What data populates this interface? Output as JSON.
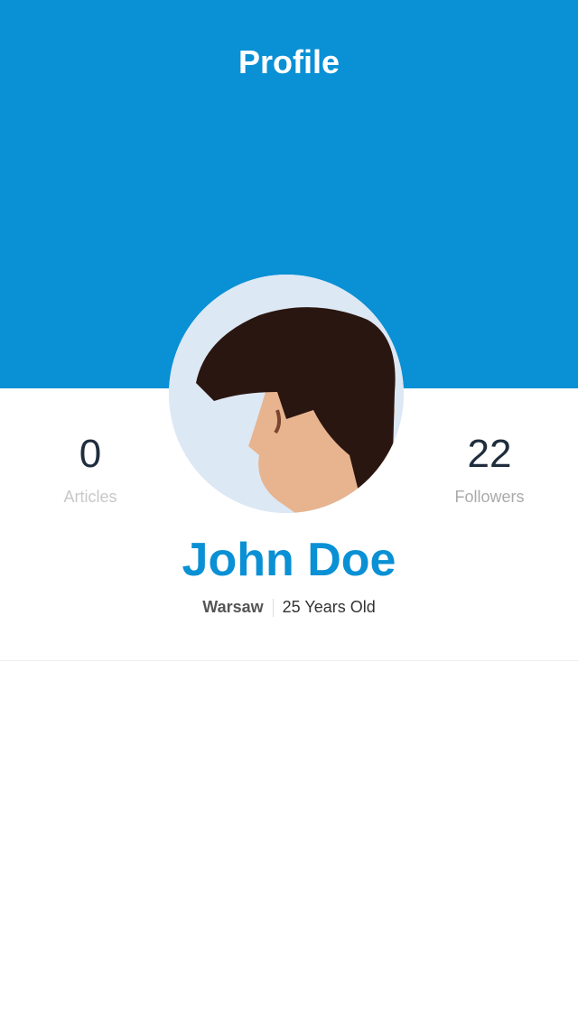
{
  "header": {
    "title": "Profile",
    "color": "#0a90d4"
  },
  "stats": [
    {
      "value": "0",
      "label": "Articles"
    },
    {
      "value": "22",
      "label": "Followers"
    }
  ],
  "profile": {
    "name": "John Doe",
    "city": "Warsaw",
    "age": "25 Years Old"
  }
}
